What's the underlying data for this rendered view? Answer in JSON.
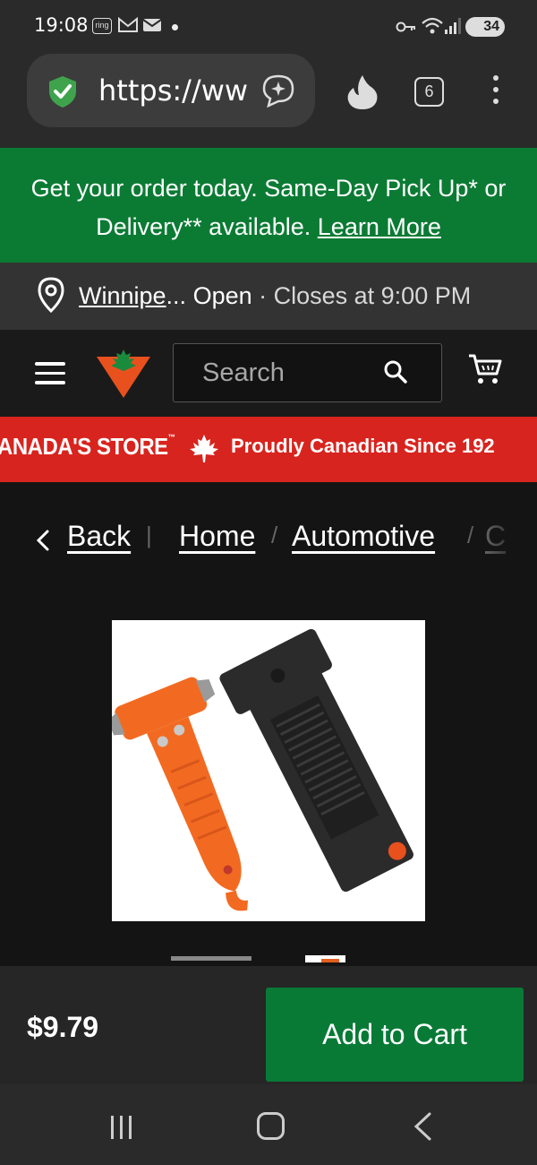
{
  "status_bar": {
    "time": "19:08",
    "ring_label": "ring",
    "battery": "34"
  },
  "browser": {
    "url": "https://ww",
    "tab_count": "6"
  },
  "promo": {
    "text": "Get your order today. Same-Day Pick Up* or Delivery** available.",
    "link": "Learn More"
  },
  "store": {
    "city": "Winnipe",
    "ellipsis": "...",
    "status": " Open",
    "hours": " · Closes at 9:00 PM"
  },
  "header": {
    "search_placeholder": "Search"
  },
  "banner": {
    "store_text": "ANADA'S STORE",
    "tm": "™",
    "tagline": "Proudly Canadian Since 192"
  },
  "breadcrumb": {
    "back": "Back",
    "sep1": "|",
    "home": "Home",
    "sep2": "/",
    "automotive": "Automotive",
    "sep3": "/",
    "next": "C"
  },
  "product": {
    "price": "$9.79",
    "add_to_cart": "Add to Cart"
  },
  "colors": {
    "promo_green": "#0b7b34",
    "brand_red": "#d8241e",
    "cart_green": "#087a36",
    "product_orange": "#f26a21"
  }
}
